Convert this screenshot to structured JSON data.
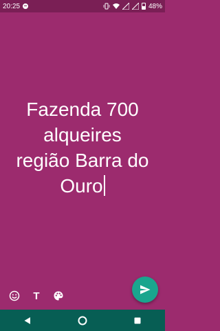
{
  "status_bar": {
    "time": "20:25",
    "battery_percent": "48%",
    "battery_level": 0.48,
    "icons": [
      "spotify-icon",
      "vibrate-icon",
      "wifi-icon",
      "signal-icon",
      "signal-icon",
      "battery-icon"
    ]
  },
  "editor": {
    "lines": [
      "Fazenda 700",
      "alqueires",
      "região Barra do",
      "Ouro"
    ],
    "background_color": "#9c2b6e"
  },
  "toolbar": {
    "emoji_icon": "emoji-icon",
    "text_label": "T",
    "palette_icon": "palette-icon"
  },
  "send": {
    "icon": "send-icon",
    "color": "#1aa58e"
  },
  "nav": {
    "back": "back-icon",
    "home": "home-icon",
    "recents": "recents-icon"
  }
}
